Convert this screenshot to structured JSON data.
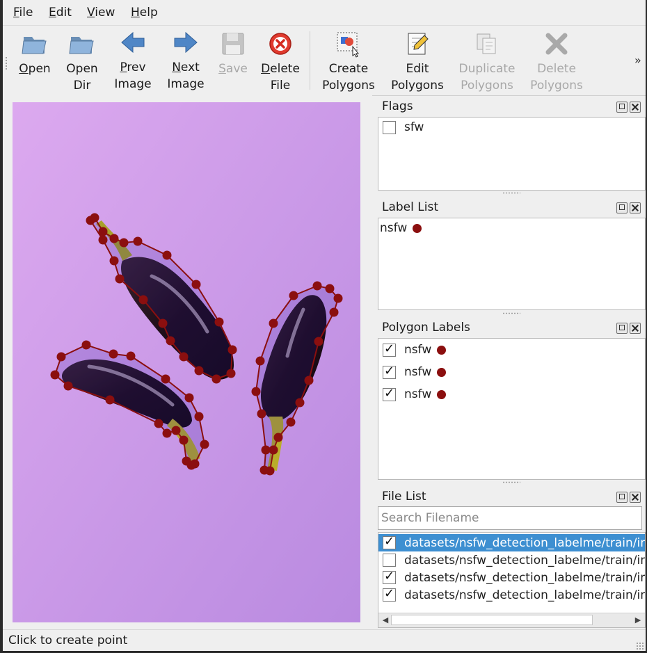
{
  "menu": {
    "file_accel": "F",
    "file_rest": "ile",
    "edit_accel": "E",
    "edit_rest": "dit",
    "view_accel": "V",
    "view_rest": "iew",
    "help_accel": "H",
    "help_rest": "elp"
  },
  "toolbar": {
    "open": {
      "accel": "O",
      "rest": "pen"
    },
    "open_dir": {
      "line1": "Open",
      "line2": "Dir"
    },
    "prev_image": {
      "accel": "P",
      "rest": "rev",
      "line2": "Image"
    },
    "next_image": {
      "accel": "N",
      "rest": "ext",
      "line2": "Image"
    },
    "save": {
      "accel": "S",
      "rest": "ave"
    },
    "delete_file": {
      "accel": "D",
      "rest": "elete",
      "line2": "File"
    },
    "create_polygons": {
      "line1": "Create",
      "line2": "Polygons"
    },
    "edit_polygons": {
      "line1": "Edit",
      "line2": "Polygons"
    },
    "duplicate_polygons": {
      "line1": "Duplicate",
      "line2": "Polygons"
    },
    "delete_polygons": {
      "line1": "Delete",
      "line2": "Polygons"
    },
    "more": "»"
  },
  "docks": {
    "flags": {
      "title": "Flags",
      "items": [
        {
          "label": "sfw",
          "checked": false
        }
      ]
    },
    "label_list": {
      "title": "Label List",
      "items": [
        {
          "label": "nsfw",
          "color": "#8b0f0f"
        }
      ]
    },
    "polygon_labels": {
      "title": "Polygon Labels",
      "items": [
        {
          "label": "nsfw",
          "checked": true,
          "color": "#8b0f0f"
        },
        {
          "label": "nsfw",
          "checked": true,
          "color": "#8b0f0f"
        },
        {
          "label": "nsfw",
          "checked": true,
          "color": "#8b0f0f"
        }
      ]
    },
    "file_list": {
      "title": "File List",
      "search_placeholder": "Search Filename",
      "items": [
        {
          "path": "datasets/nsfw_detection_labelme/train/in",
          "checked": true,
          "selected": true
        },
        {
          "path": "datasets/nsfw_detection_labelme/train/in",
          "checked": false,
          "selected": false
        },
        {
          "path": "datasets/nsfw_detection_labelme/train/in",
          "checked": true,
          "selected": false
        },
        {
          "path": "datasets/nsfw_detection_labelme/train/in",
          "checked": true,
          "selected": false
        }
      ]
    }
  },
  "status": {
    "text": "Click to create point"
  },
  "colors": {
    "polygon": "#8b0f0f",
    "background_top": "#d9a6ee",
    "background_bottom": "#b98be0",
    "selection": "#3d8fd1"
  },
  "icons": {
    "open": "folder-open-icon",
    "open_dir": "folder-open-icon",
    "prev": "arrow-left-icon",
    "next": "arrow-right-icon",
    "save": "floppy-disk-icon",
    "delete_file": "delete-circle-icon",
    "create_polygons": "create-polygon-icon",
    "edit_polygons": "edit-pencil-icon",
    "duplicate_polygons": "duplicate-icon",
    "delete_polygons": "delete-x-icon"
  }
}
